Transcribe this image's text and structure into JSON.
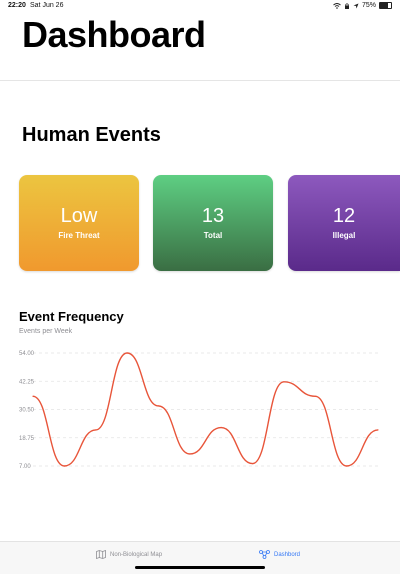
{
  "status_bar": {
    "time": "22:20",
    "date": "Sat Jun 26",
    "battery": "75%",
    "battery_fraction": 0.75
  },
  "header": {
    "title": "Dashboard"
  },
  "section": {
    "title": "Human Events"
  },
  "cards": [
    {
      "value": "Low",
      "label": "Fire Threat",
      "color_top": "#ecc540",
      "color_bottom": "#f0992e"
    },
    {
      "value": "13",
      "label": "Total",
      "color_top": "#5ecf83",
      "color_bottom": "#3a6e43"
    },
    {
      "value": "12",
      "label": "Illegal",
      "color_top": "#8d59be",
      "color_bottom": "#5a2a8a"
    }
  ],
  "chart": {
    "title": "Event Frequency",
    "subtitle": "Events per Week"
  },
  "chart_data": {
    "type": "line",
    "title": "Event Frequency",
    "subtitle": "Events per Week",
    "y_ticks": [
      "54.00",
      "42.25",
      "30.50",
      "18.75",
      "7.00"
    ],
    "ylim": [
      7,
      54
    ],
    "grid": "dashed horizontal",
    "line_color": "#e8553a",
    "x": [
      1,
      2,
      3,
      4,
      5,
      6,
      7,
      8,
      9,
      10,
      11,
      12
    ],
    "values": [
      36,
      7,
      22,
      54,
      32,
      12,
      23,
      8,
      42,
      36,
      7,
      22
    ]
  },
  "tab_bar": {
    "tabs": [
      {
        "label": "Non-Biological Map",
        "icon": "map-icon",
        "active": false
      },
      {
        "label": "Dashbord",
        "icon": "network-icon",
        "active": true
      }
    ]
  }
}
